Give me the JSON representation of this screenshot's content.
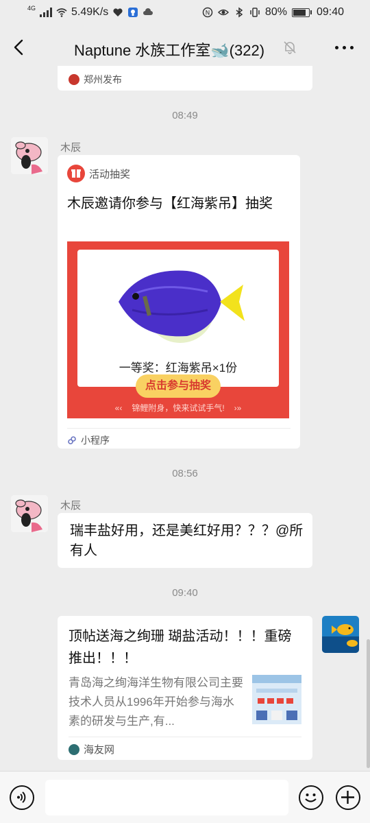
{
  "status_bar": {
    "network_type": "4G",
    "speed": "5.49K/s",
    "battery": "80%",
    "battery_level": 0.8,
    "time": "09:40"
  },
  "header": {
    "title": "Naptune 水族工作室🐋(322)",
    "icons": [
      "back-arrow-icon",
      "mute-bell-icon",
      "more-dots-icon"
    ]
  },
  "messages": {
    "prev_card": {
      "source": "郑州发布"
    },
    "time1": "08:49",
    "msg1": {
      "sender": "木辰",
      "app_name": "活动抽奖",
      "title": "木辰邀请你参与【红海紫吊】抽奖",
      "prize": "一等奖：红海紫吊×1份",
      "cta": "点击参与抽奖",
      "slogan": "锦鲤附身，快来试试手气!",
      "footer": "小程序"
    },
    "time2": "08:56",
    "msg2": {
      "sender": "木辰",
      "text": "瑞丰盐好用，还是美红好用？？？@所有人"
    },
    "time3": "09:40",
    "msg3": {
      "title": "顶帖送海之绚珊 瑚盐活动！！！重磅推出！！！",
      "desc": "青岛海之绚海洋生物有限公司主要技术人员从1996年开始参与海水素的研发与生产,有...",
      "source": "海友网"
    }
  },
  "colors": {
    "background": "#ededed",
    "bubble": "#ffffff",
    "lottery_red": "#e8463b",
    "cta_yellow": "#f9d162"
  }
}
